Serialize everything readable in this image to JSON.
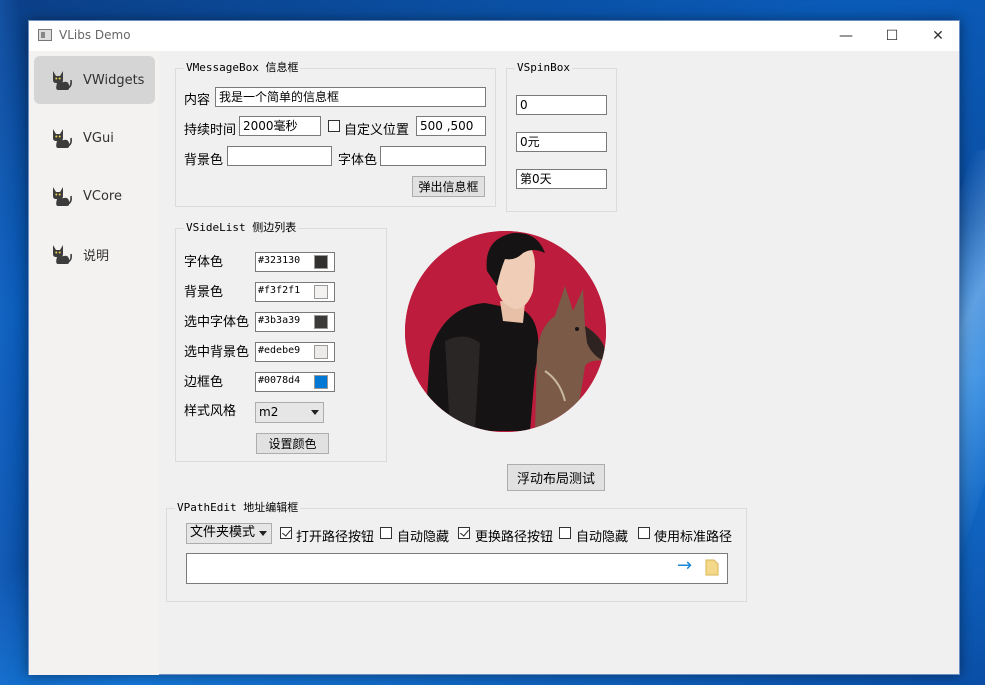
{
  "window": {
    "title": "VLibs Demo",
    "minimize_glyph": "—",
    "maximize_glyph": "☐",
    "close_glyph": "✕"
  },
  "sidebar": {
    "items": [
      {
        "label": "VWidgets",
        "icon": "cat-icon",
        "selected": true
      },
      {
        "label": "VGui",
        "icon": "cat-icon",
        "selected": false
      },
      {
        "label": "VCore",
        "icon": "cat-icon",
        "selected": false
      },
      {
        "label": "说明",
        "icon": "cat-icon",
        "selected": false
      }
    ]
  },
  "message_box": {
    "title": "VMessageBox 信息框",
    "content_label": "内容",
    "content_value": "我是一个简单的信息框",
    "duration_label": "持续时间",
    "duration_value": "2000毫秒",
    "custom_pos_label": "自定义位置",
    "position_value": "500 ,500",
    "bg_label": "背景色",
    "bg_value": "",
    "font_label": "字体色",
    "font_value": "",
    "popup_button": "弹出信息框"
  },
  "spin_box": {
    "title": "VSpinBox",
    "values": [
      "0",
      "0元",
      "第0天"
    ]
  },
  "side_list": {
    "title": "VSideList 侧边列表",
    "rows": [
      {
        "label": "字体色",
        "value": "#323130",
        "color": "#323130"
      },
      {
        "label": "背景色",
        "value": "#f3f2f1",
        "color": "#f3f2f1"
      },
      {
        "label": "选中字体色",
        "value": "#3b3a39",
        "color": "#3b3a39"
      },
      {
        "label": "选中背景色",
        "value": "#edebe9",
        "color": "#edebe9"
      },
      {
        "label": "边框色",
        "value": "#0078d4",
        "color": "#0078d4"
      }
    ],
    "style_label": "样式风格",
    "style_value": "m2",
    "set_color_button": "设置颜色"
  },
  "float_layout_button": "浮动布局测试",
  "path_edit": {
    "title": "VPathEdit 地址编辑框",
    "mode_value": "文件夹模式",
    "options": [
      {
        "label": "打开路径按钮",
        "checked": true
      },
      {
        "label": "自动隐藏",
        "checked": false
      },
      {
        "label": "更换路径按钮",
        "checked": true
      },
      {
        "label": "自动隐藏",
        "checked": false
      },
      {
        "label": "使用标准路径",
        "checked": false
      }
    ],
    "path_value": "",
    "go_glyph": "→"
  }
}
